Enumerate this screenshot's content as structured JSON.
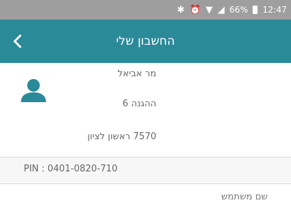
{
  "status_bar": {
    "icons": [
      "bluetooth-icon",
      "alarm-icon",
      "wifi-icon",
      "signal-icon",
      "battery-icon"
    ],
    "battery_percent": "66%",
    "time": "12:47"
  },
  "app_bar": {
    "title": "החשבון שלי",
    "color": "#2b8a98",
    "back_icon": "chevron-left-icon"
  },
  "profile": {
    "avatar_icon": "person-icon",
    "avatar_color": "#2b8a98",
    "name": "מר אביאל",
    "street": "ההגנה 6",
    "city": "7570 ראשון לציון"
  },
  "pin": {
    "text": "PIN : 0401-0820-710"
  },
  "username": {
    "label": "שם משתמש"
  }
}
